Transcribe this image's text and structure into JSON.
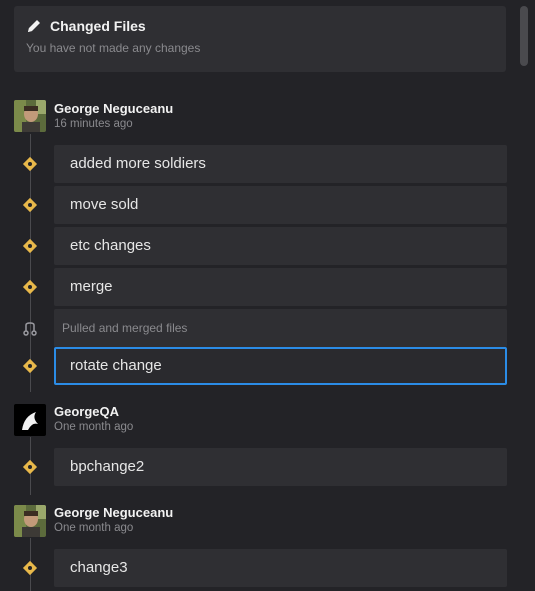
{
  "changed_files": {
    "title": "Changed Files",
    "subtitle": "You have not made any changes"
  },
  "groups": [
    {
      "author": "George Neguceanu",
      "time": "16 minutes ago",
      "commits": [
        "added more soldiers",
        "move sold",
        "etc changes",
        "merge",
        "Pulled and merged files",
        "rotate change"
      ]
    },
    {
      "author": "GeorgeQA",
      "time": "One month ago",
      "commits": [
        "bpchange2"
      ]
    },
    {
      "author": "George Neguceanu",
      "time": "One month ago",
      "commits": [
        "change3"
      ]
    }
  ],
  "icons": {
    "commit": "git-commit-icon",
    "merge": "git-merge-icon",
    "edit": "pencil-icon"
  },
  "colors": {
    "accent": "#2b8ce6",
    "commit_icon": "#e8b84a"
  }
}
